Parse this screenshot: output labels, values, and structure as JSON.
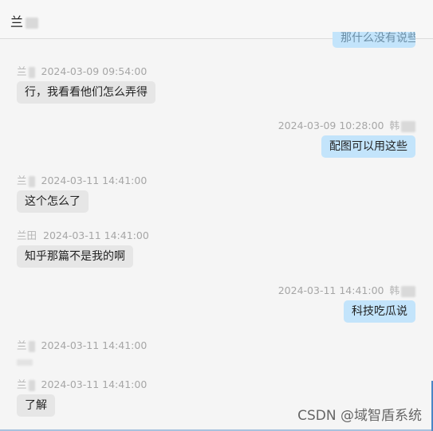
{
  "header": {
    "title": "兰"
  },
  "partial_message": {
    "text": "那什么没有说些"
  },
  "messages": [
    {
      "side": "left",
      "sender": "兰",
      "time": "2024-03-09 09:54:00",
      "text": "行，我看看他们怎么弄得"
    },
    {
      "side": "right",
      "sender": "韩",
      "time": "2024-03-09 10:28:00",
      "text": "配图可以用这些"
    },
    {
      "side": "left",
      "sender": "兰",
      "time": "2024-03-11 14:41:00",
      "text": "这个怎么了"
    },
    {
      "side": "left",
      "sender": "兰田",
      "time": "2024-03-11 14:41:00",
      "text": "知乎那篇不是我的啊"
    },
    {
      "side": "right",
      "sender": "韩",
      "time": "2024-03-11 14:41:00",
      "text": "科技吃瓜说"
    },
    {
      "side": "left",
      "sender": "兰",
      "time": "2024-03-11 14:41:00",
      "text": ""
    },
    {
      "side": "left",
      "sender": "兰",
      "time": "2024-03-11 14:41:00",
      "text": "了解"
    }
  ],
  "watermark": "CSDN @域智盾系统"
}
